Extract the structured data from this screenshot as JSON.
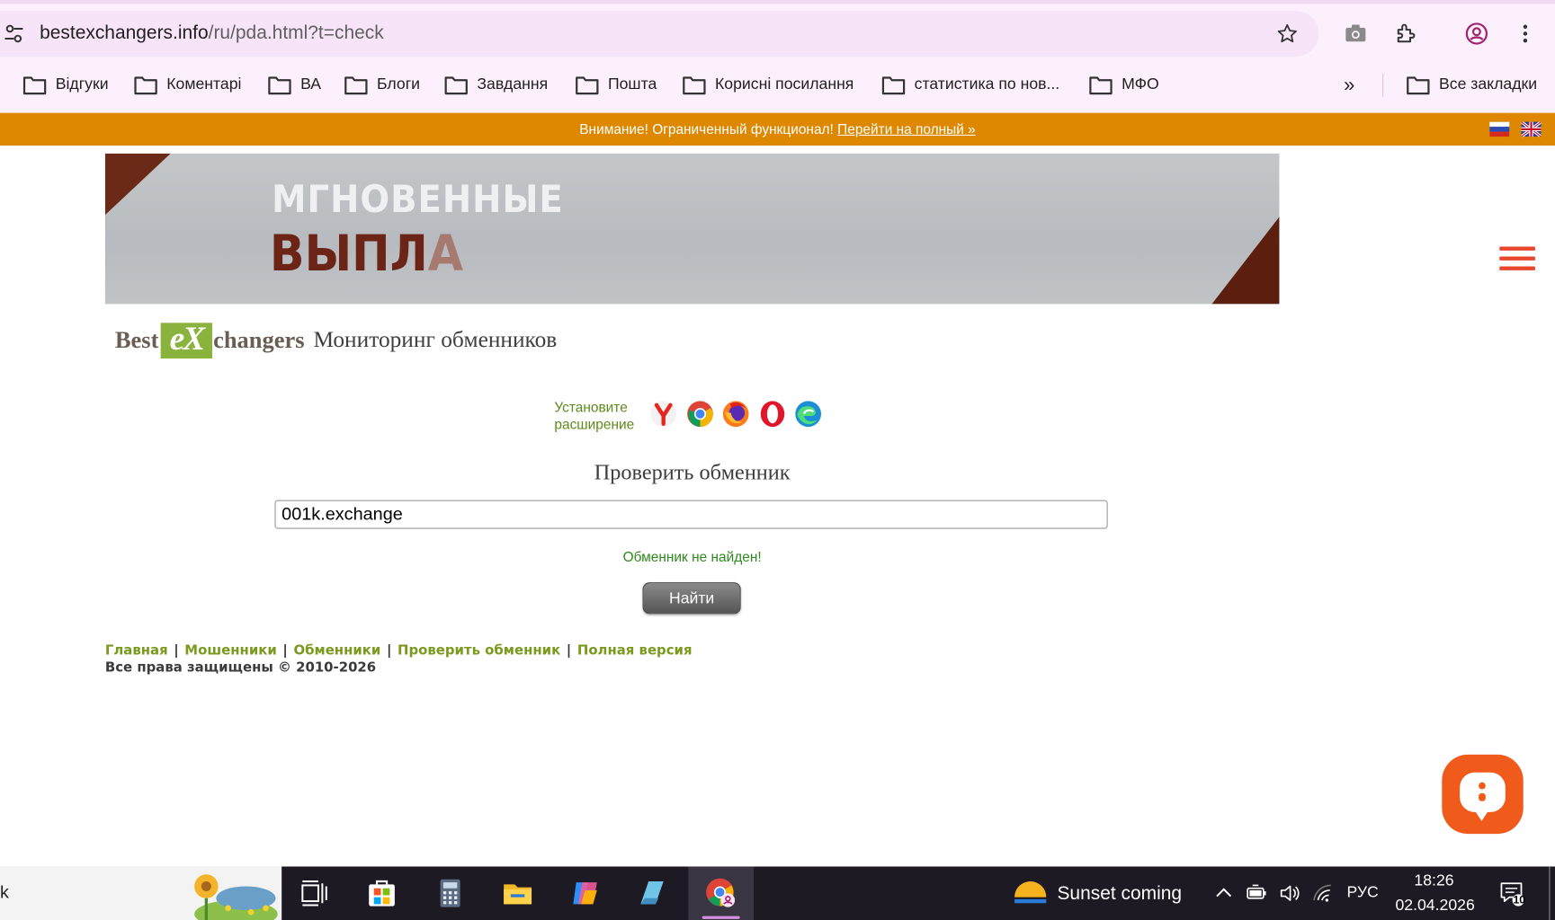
{
  "browser": {
    "url_host": "bestexchangers.info",
    "url_path": "/ru/pda.html?t=check",
    "bookmarks": [
      "Відгуки",
      "Коментарі",
      "ВА",
      "Блоги",
      "Завдання",
      "Пошта",
      "Корисні посилання",
      "статистика по нов...",
      "МФО"
    ],
    "overflow": "»",
    "all_bookmarks": "Все закладки"
  },
  "notice": {
    "text": "Внимание! Ограниченный функционал!",
    "link": "Перейти на полный »"
  },
  "banner": {
    "line1": "МГНОВЕННЫЕ",
    "line2_main": "ВЫПЛ",
    "line2_fade": "А"
  },
  "logo": {
    "best": "Best",
    "ex": "eX",
    "changers": "changers",
    "tagline": "Мониторинг обменников"
  },
  "extensions": {
    "label_line1": "Установите",
    "label_line2": "расширение",
    "browsers": [
      "yandex-icon",
      "chrome-icon",
      "firefox-icon",
      "opera-icon",
      "edge-icon"
    ]
  },
  "check": {
    "title": "Проверить обменник",
    "input_value": "001k.exchange",
    "result": "Обменник не найден!",
    "button": "Найти"
  },
  "footer": {
    "links": [
      "Главная",
      "Мошенники",
      "Обменники",
      "Проверить обменник",
      "Полная версия"
    ],
    "separator": "|",
    "copyright": "Все права защищены © 2010-2026"
  },
  "taskbar": {
    "left_text": "k",
    "weather": "Sunset coming",
    "lang": "РУС",
    "time": "18:26",
    "date": "02.04.2026",
    "notifications": "10"
  },
  "colors": {
    "notice_bg": "#dd8800",
    "link_green": "#7a9a1d",
    "result_green": "#2d8a1d",
    "chat_orange": "#f05a1a",
    "hamburger_red": "#e8472d"
  }
}
